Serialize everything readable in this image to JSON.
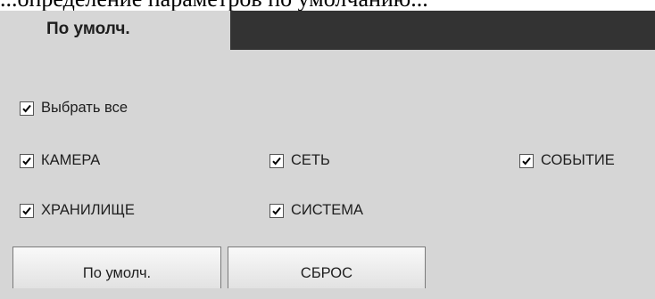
{
  "caption_fragment": "...определение параметров по умолчанию...",
  "tabs": {
    "active_label": "По умолч."
  },
  "checkboxes": {
    "select_all": {
      "label": "Выбрать все",
      "checked": true
    },
    "camera": {
      "label": "КАМЕРА",
      "checked": true
    },
    "network": {
      "label": "СЕТЬ",
      "checked": true
    },
    "event": {
      "label": "СОБЫТИЕ",
      "checked": true
    },
    "storage": {
      "label": "ХРАНИЛИЩЕ",
      "checked": true
    },
    "system": {
      "label": "СИСТЕМА",
      "checked": true
    }
  },
  "buttons": {
    "default_label": "По умолч.",
    "reset_label": "СБРОС"
  },
  "colors": {
    "panel_bg": "#d6d6d6",
    "tab_dark": "#333333",
    "text": "#1e1e1e"
  }
}
